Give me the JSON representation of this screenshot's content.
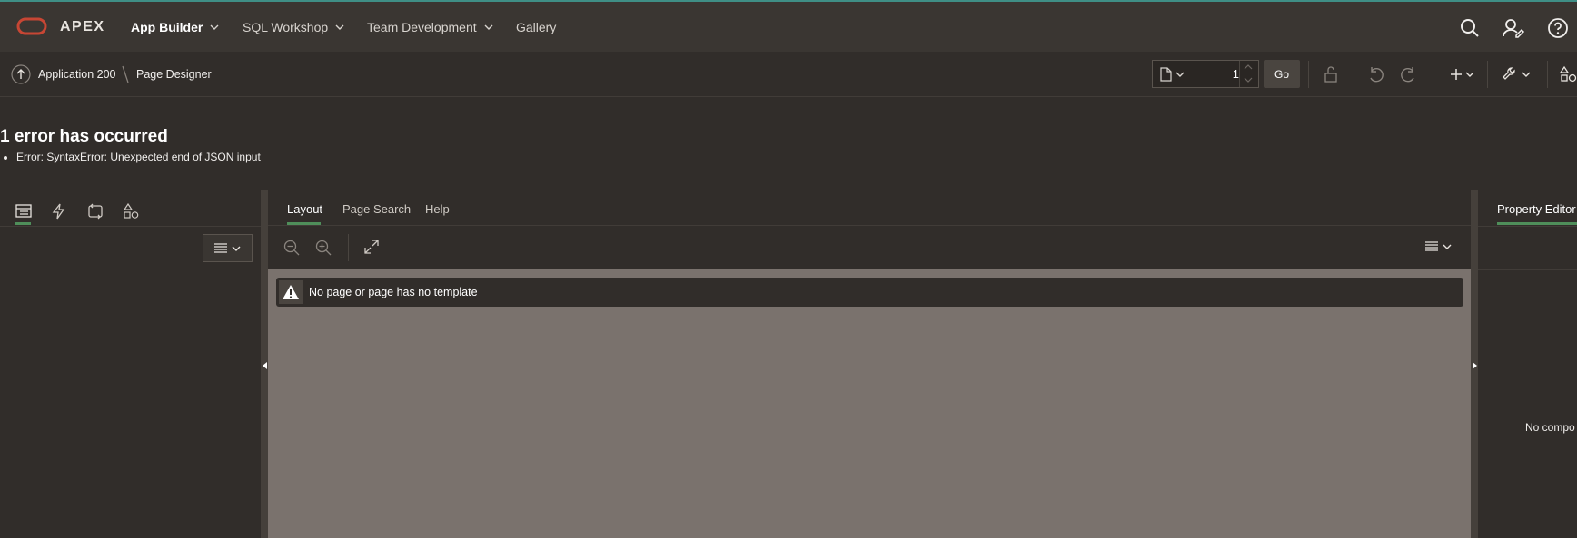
{
  "topnav": {
    "brand": "APEX",
    "items": [
      {
        "label": "App Builder",
        "has_menu": true
      },
      {
        "label": "SQL Workshop",
        "has_menu": true
      },
      {
        "label": "Team Development",
        "has_menu": true
      },
      {
        "label": "Gallery",
        "has_menu": false
      }
    ]
  },
  "toolbar": {
    "breadcrumb_app": "Application 200",
    "breadcrumb_page": "Page Designer",
    "page_number": "1",
    "go_label": "Go"
  },
  "error": {
    "title": "1 error has occurred",
    "message": "Error: SyntaxError: Unexpected end of JSON input"
  },
  "center": {
    "tabs": [
      "Layout",
      "Page Search",
      "Help"
    ],
    "warning": "No page or page has no template"
  },
  "right": {
    "tab": "Property Editor",
    "message": "No compo"
  },
  "colors": {
    "accent_tab": "#4f8e5a",
    "oracle_red": "#c74634",
    "canvas": "#7a726d"
  }
}
